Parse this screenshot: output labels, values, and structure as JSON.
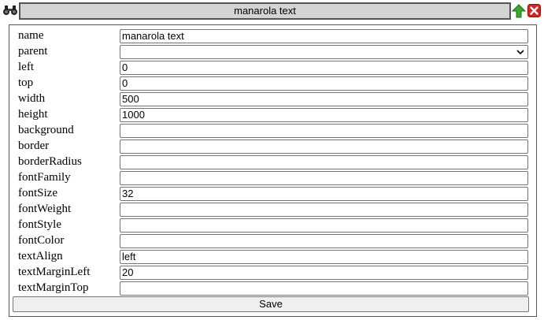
{
  "header": {
    "title": "manarola text",
    "binoculars_icon": "binoculars-icon",
    "up_icon": "arrow-up-icon",
    "close_icon": "close-icon",
    "colors": {
      "up": "#3aa82e",
      "close": "#d9231e"
    }
  },
  "form": {
    "fields": [
      {
        "label": "name",
        "value": "manarola text"
      },
      {
        "label": "parent",
        "value": "",
        "type": "select"
      },
      {
        "label": "left",
        "value": "0"
      },
      {
        "label": "top",
        "value": "0"
      },
      {
        "label": "width",
        "value": "500"
      },
      {
        "label": "height",
        "value": "1000"
      },
      {
        "label": "background",
        "value": ""
      },
      {
        "label": "border",
        "value": ""
      },
      {
        "label": "borderRadius",
        "value": ""
      },
      {
        "label": "fontFamily",
        "value": ""
      },
      {
        "label": "fontSize",
        "value": "32"
      },
      {
        "label": "fontWeight",
        "value": ""
      },
      {
        "label": "fontStyle",
        "value": ""
      },
      {
        "label": "fontColor",
        "value": ""
      },
      {
        "label": "textAlign",
        "value": "left"
      },
      {
        "label": "textMarginLeft",
        "value": "20"
      },
      {
        "label": "textMarginTop",
        "value": ""
      }
    ],
    "save_label": "Save"
  }
}
